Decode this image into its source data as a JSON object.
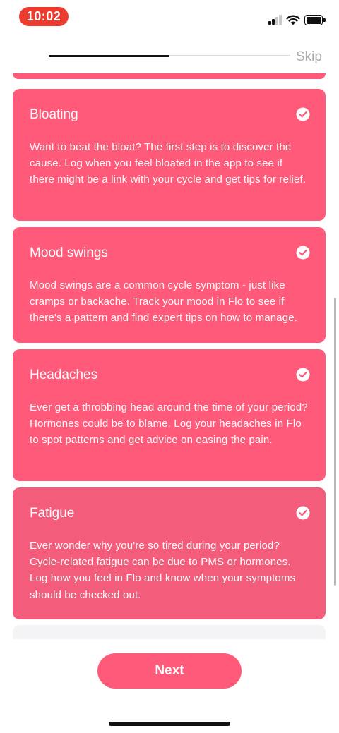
{
  "status_bar": {
    "time": "10:02"
  },
  "onboarding": {
    "progress_fraction": 0.5,
    "skip_label": "Skip"
  },
  "cards": [
    {
      "title": "Bloating",
      "selected": true,
      "body": "Want to beat the bloat? The first step is to discover the cause. Log when you feel bloated in the app to see if there might be a link with your cycle and get tips for relief."
    },
    {
      "title": "Mood swings",
      "selected": true,
      "body": "Mood swings are a common cycle symptom - just like cramps or backache. Track your mood in Flo to see if there's a pattern and find expert tips on how to manage."
    },
    {
      "title": "Headaches",
      "selected": true,
      "body": "Ever get a throbbing head around the time of your period? Hormones could be to blame. Log your headaches in Flo to spot patterns and get advice on easing the pain."
    },
    {
      "title": "Fatigue",
      "selected": true,
      "body": "Ever wonder why you're so tired during your period? Cycle-related fatigue can be due to PMS or hormones. Log how you feel in Flo and know when your symptoms should be checked out."
    }
  ],
  "footer": {
    "next_label": "Next"
  },
  "colors": {
    "card": "#ff5a79",
    "time_pill": "#ec3b2f",
    "skip": "#a9a9ae"
  }
}
